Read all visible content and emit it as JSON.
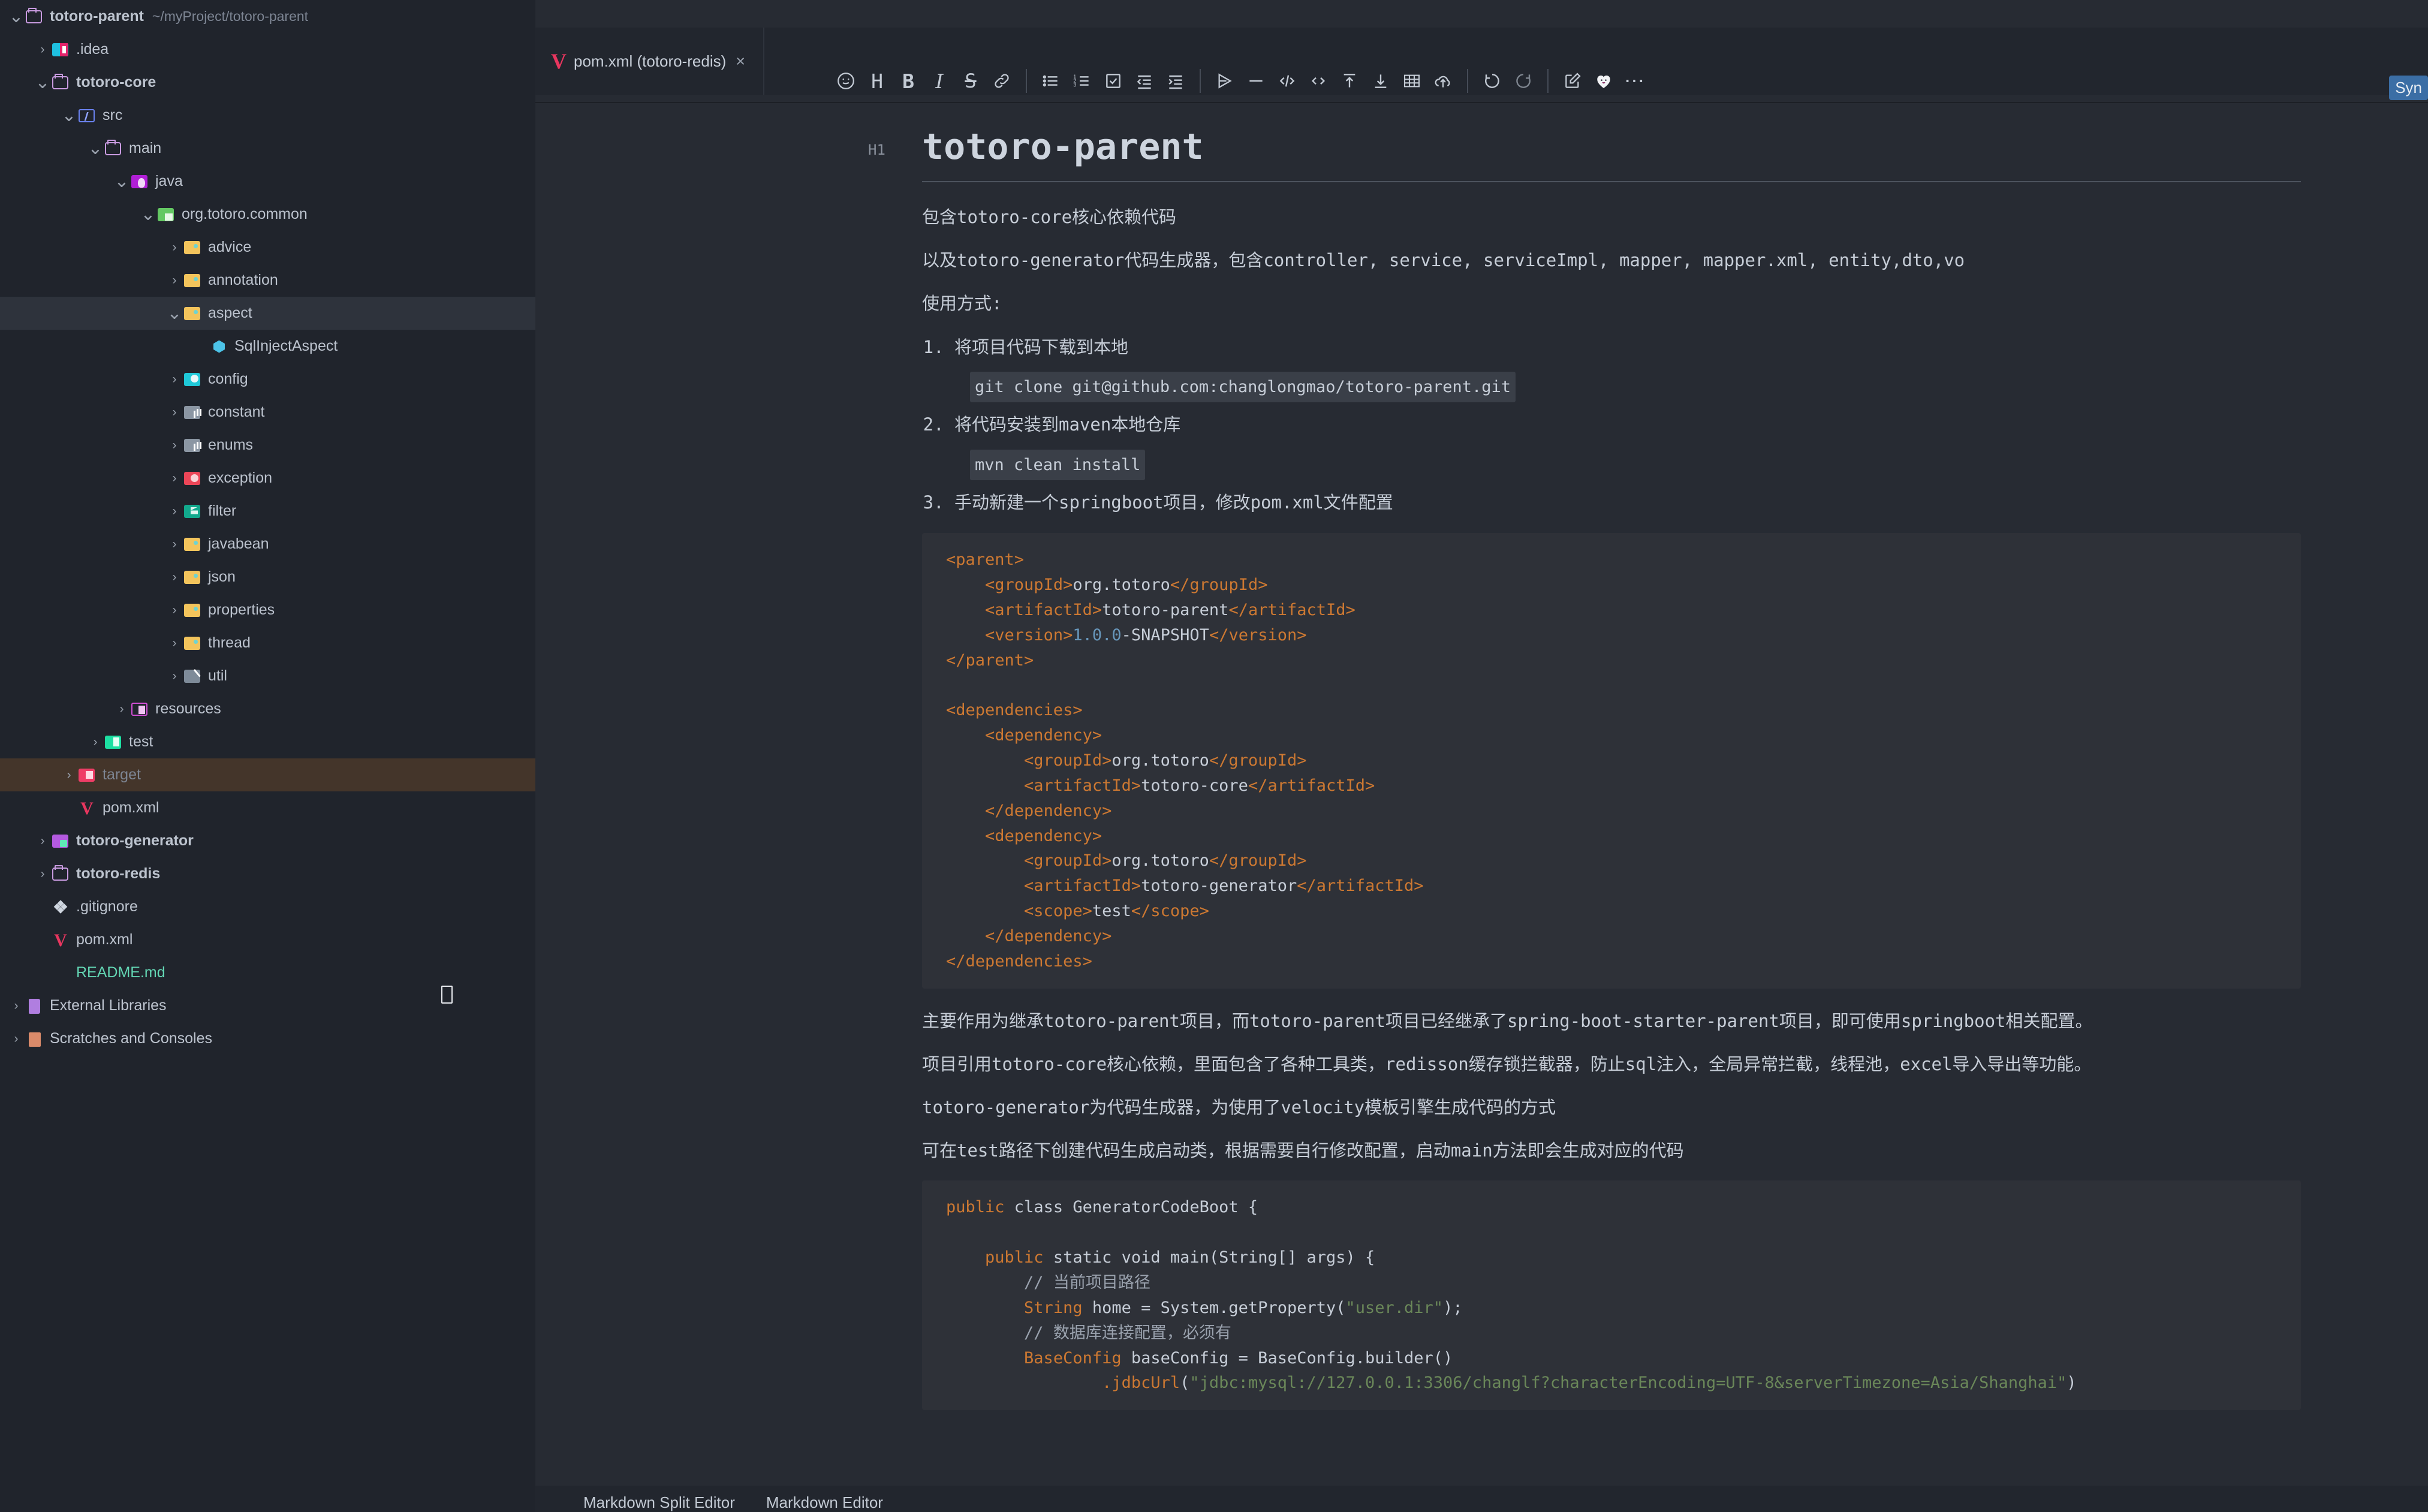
{
  "window": {
    "sync_badge": "Syn"
  },
  "sidebar": {
    "items": [
      {
        "label": "totoro-parent",
        "path": "~/myProject/totoro-parent",
        "indent": 0,
        "arrow": "v",
        "icon": "folder-plain-icon",
        "iconclass": "fi plain",
        "bold": true,
        "state": "normal"
      },
      {
        "label": ".idea",
        "path": "",
        "indent": 1,
        "arrow": ">",
        "icon": "idea-folder-icon",
        "iconclass": "fi idea",
        "bold": false,
        "state": "normal"
      },
      {
        "label": "totoro-core",
        "path": "",
        "indent": 1,
        "arrow": "v",
        "icon": "folder-plain-icon",
        "iconclass": "fi plain",
        "bold": true,
        "state": "normal"
      },
      {
        "label": "src",
        "path": "",
        "indent": 2,
        "arrow": "v",
        "icon": "source-root-icon",
        "iconclass": "fi srcblue",
        "bold": false,
        "state": "normal"
      },
      {
        "label": "main",
        "path": "",
        "indent": 3,
        "arrow": "v",
        "icon": "folder-plain-icon",
        "iconclass": "fi plain",
        "bold": false,
        "state": "normal"
      },
      {
        "label": "java",
        "path": "",
        "indent": 4,
        "arrow": "v",
        "icon": "java-source-folder-icon",
        "iconclass": "fi javafolder",
        "bold": false,
        "state": "normal"
      },
      {
        "label": "org.totoro.common",
        "path": "",
        "indent": 5,
        "arrow": "v",
        "icon": "package-icon",
        "iconclass": "fi greenpkg",
        "bold": false,
        "state": "normal"
      },
      {
        "label": "advice",
        "path": "",
        "indent": 6,
        "arrow": ">",
        "icon": "folder-yellow-icon",
        "iconclass": "fi yellow",
        "bold": false,
        "state": "normal"
      },
      {
        "label": "annotation",
        "path": "",
        "indent": 6,
        "arrow": ">",
        "icon": "folder-yellow-icon",
        "iconclass": "fi yellow",
        "bold": false,
        "state": "normal"
      },
      {
        "label": "aspect",
        "path": "",
        "indent": 6,
        "arrow": "v",
        "icon": "folder-yellow-icon",
        "iconclass": "fi yellow",
        "bold": false,
        "state": "selected"
      },
      {
        "label": "SqlInjectAspect",
        "path": "",
        "indent": 7,
        "arrow": "",
        "icon": "java-class-icon",
        "iconclass": "fx javacls",
        "bold": false,
        "state": "normal"
      },
      {
        "label": "config",
        "path": "",
        "indent": 6,
        "arrow": ">",
        "icon": "folder-config-icon",
        "iconclass": "fi cyan",
        "bold": false,
        "state": "normal"
      },
      {
        "label": "constant",
        "path": "",
        "indent": 6,
        "arrow": ">",
        "icon": "folder-constant-icon",
        "iconclass": "fi grey",
        "bold": false,
        "state": "normal"
      },
      {
        "label": "enums",
        "path": "",
        "indent": 6,
        "arrow": ">",
        "icon": "folder-enum-icon",
        "iconclass": "fi grey",
        "bold": false,
        "state": "normal"
      },
      {
        "label": "exception",
        "path": "",
        "indent": 6,
        "arrow": ">",
        "icon": "folder-exception-icon",
        "iconclass": "fi red",
        "bold": false,
        "state": "normal"
      },
      {
        "label": "filter",
        "path": "",
        "indent": 6,
        "arrow": ">",
        "icon": "folder-filter-icon",
        "iconclass": "fi teal",
        "bold": false,
        "state": "normal"
      },
      {
        "label": "javabean",
        "path": "",
        "indent": 6,
        "arrow": ">",
        "icon": "folder-yellow-icon",
        "iconclass": "fi yellow",
        "bold": false,
        "state": "normal"
      },
      {
        "label": "json",
        "path": "",
        "indent": 6,
        "arrow": ">",
        "icon": "folder-json-icon",
        "iconclass": "fi yellow",
        "bold": false,
        "state": "normal"
      },
      {
        "label": "properties",
        "path": "",
        "indent": 6,
        "arrow": ">",
        "icon": "folder-yellow-icon",
        "iconclass": "fi yellow",
        "bold": false,
        "state": "normal"
      },
      {
        "label": "thread",
        "path": "",
        "indent": 6,
        "arrow": ">",
        "icon": "folder-yellow-icon",
        "iconclass": "fi yellow",
        "bold": false,
        "state": "normal"
      },
      {
        "label": "util",
        "path": "",
        "indent": 6,
        "arrow": ">",
        "icon": "folder-util-icon",
        "iconclass": "fi greysl",
        "bold": false,
        "state": "normal"
      },
      {
        "label": "resources",
        "path": "",
        "indent": 4,
        "arrow": ">",
        "icon": "resources-root-icon",
        "iconclass": "fi magenta",
        "bold": false,
        "state": "normal"
      },
      {
        "label": "test",
        "path": "",
        "indent": 3,
        "arrow": ">",
        "icon": "test-root-icon",
        "iconclass": "fi emerald",
        "bold": false,
        "state": "normal"
      },
      {
        "label": "target",
        "path": "",
        "indent": 2,
        "arrow": ">",
        "icon": "excluded-folder-icon",
        "iconclass": "fi pinkred",
        "bold": false,
        "state": "target"
      },
      {
        "label": "pom.xml",
        "path": "",
        "indent": 2,
        "arrow": "",
        "icon": "maven-file-icon",
        "iconclass": "fx maven",
        "bold": false,
        "state": "normal"
      },
      {
        "label": "totoro-generator",
        "path": "",
        "indent": 1,
        "arrow": ">",
        "icon": "module-folder-icon",
        "iconclass": "fi purple",
        "bold": true,
        "state": "normal"
      },
      {
        "label": "totoro-redis",
        "path": "",
        "indent": 1,
        "arrow": ">",
        "icon": "folder-plain-icon",
        "iconclass": "fi plain",
        "bold": true,
        "state": "normal"
      },
      {
        "label": ".gitignore",
        "path": "",
        "indent": 1,
        "arrow": "",
        "icon": "git-file-icon",
        "iconclass": "fx git",
        "bold": false,
        "state": "normal"
      },
      {
        "label": "pom.xml",
        "path": "",
        "indent": 1,
        "arrow": "",
        "icon": "maven-file-icon",
        "iconclass": "fx maven",
        "bold": false,
        "state": "normal"
      },
      {
        "label": "README.md",
        "path": "",
        "indent": 1,
        "arrow": "",
        "icon": "markdown-file-icon",
        "iconclass": "fx md",
        "bold": false,
        "state": "green"
      },
      {
        "label": "External Libraries",
        "path": "",
        "indent": 0,
        "arrow": ">",
        "icon": "library-icon",
        "iconclass": "fx lib",
        "bold": false,
        "state": "normal"
      },
      {
        "label": "Scratches and Consoles",
        "path": "",
        "indent": 0,
        "arrow": ">",
        "icon": "scratches-icon",
        "iconclass": "fx scratch",
        "bold": false,
        "state": "normal"
      }
    ]
  },
  "editor": {
    "tab": {
      "label": "pom.xml (totoro-redis)",
      "close": "×",
      "icon": "V"
    },
    "toolbar": [
      {
        "name": "emoji-icon",
        "label": "emoji"
      },
      {
        "name": "heading-icon",
        "label": "H"
      },
      {
        "name": "bold-icon",
        "label": "B"
      },
      {
        "name": "italic-icon",
        "label": "I"
      },
      {
        "name": "strikethrough-icon",
        "label": "S"
      },
      {
        "name": "link-icon",
        "label": "link"
      },
      {
        "name": "bullet-list-icon",
        "label": "bullet list"
      },
      {
        "name": "numbered-list-icon",
        "label": "numbered list"
      },
      {
        "name": "task-list-icon",
        "label": "task list"
      },
      {
        "name": "outdent-icon",
        "label": "outdent"
      },
      {
        "name": "indent-icon",
        "label": "indent"
      },
      {
        "name": "blockquote-icon",
        "label": "blockquote"
      },
      {
        "name": "horizontal-rule-icon",
        "label": "horizontal rule"
      },
      {
        "name": "code-block-icon",
        "label": "code block"
      },
      {
        "name": "inline-code-icon",
        "label": "inline code"
      },
      {
        "name": "move-up-icon",
        "label": "move up"
      },
      {
        "name": "move-down-icon",
        "label": "move down"
      },
      {
        "name": "table-icon",
        "label": "table"
      },
      {
        "name": "upload-icon",
        "label": "upload"
      },
      {
        "name": "undo-icon",
        "label": "undo"
      },
      {
        "name": "redo-icon",
        "label": "redo"
      },
      {
        "name": "edit-icon",
        "label": "edit"
      },
      {
        "name": "heart-icon",
        "label": "heart"
      },
      {
        "name": "more-icon",
        "label": "more"
      }
    ],
    "bottom_tabs": [
      {
        "label": "Markdown Split Editor"
      },
      {
        "label": "Markdown Editor"
      }
    ]
  },
  "document": {
    "h1_marker": "H1",
    "title": "totoro-parent",
    "p1": "包含totoro-core核心依赖代码",
    "p2": "以及totoro-generator代码生成器，包含controller, service, serviceImpl, mapper, mapper.xml, entity,dto,vo",
    "p3": "使用方式:",
    "list": [
      {
        "text_before": "将项目代码下载到本地",
        "code": "git clone git@github.com:changlongmao/totoro-parent.git"
      },
      {
        "text_before": "将代码安装到maven本地仓库",
        "code": "mvn clean install"
      },
      {
        "text_before": "手动新建一个springboot项目，修改pom.xml文件配置",
        "code": ""
      }
    ],
    "xml_block": {
      "lines": [
        {
          "tag": "<parent>",
          "indent": 0
        },
        {
          "tag": "<groupId>",
          "value": "org.totoro",
          "close": "</groupId>",
          "indent": 1
        },
        {
          "tag": "<artifactId>",
          "value": "totoro-parent",
          "close": "</artifactId>",
          "indent": 1
        },
        {
          "tag": "<version>",
          "value": "1.0.0-SNAPSHOT",
          "close": "</version>",
          "indent": 1
        },
        {
          "tag": "</parent>",
          "indent": 0
        },
        {
          "tag": "",
          "indent": 0
        },
        {
          "tag": "<dependencies>",
          "indent": 0
        },
        {
          "tag": "<dependency>",
          "indent": 1
        },
        {
          "tag": "<groupId>",
          "value": "org.totoro",
          "close": "</groupId>",
          "indent": 2
        },
        {
          "tag": "<artifactId>",
          "value": "totoro-core",
          "close": "</artifactId>",
          "indent": 2
        },
        {
          "tag": "</dependency>",
          "indent": 1
        },
        {
          "tag": "<dependency>",
          "indent": 1
        },
        {
          "tag": "<groupId>",
          "value": "org.totoro",
          "close": "</groupId>",
          "indent": 2
        },
        {
          "tag": "<artifactId>",
          "value": "totoro-generator",
          "close": "</artifactId>",
          "indent": 2
        },
        {
          "tag": "<scope>",
          "value": "test",
          "close": "</scope>",
          "indent": 2
        },
        {
          "tag": "</dependency>",
          "indent": 1
        },
        {
          "tag": "</dependencies>",
          "indent": 0
        }
      ]
    },
    "p4": "主要作用为继承totoro-parent项目，而totoro-parent项目已经继承了spring-boot-starter-parent项目，即可使用springboot相关配置。",
    "p5": "项目引用totoro-core核心依赖，里面包含了各种工具类，redisson缓存锁拦截器，防止sql注入，全局异常拦截，线程池，excel导入导出等功能。",
    "p6": "totoro-generator为代码生成器，为使用了velocity模板引擎生成代码的方式",
    "p7": "可在test路径下创建代码生成启动类，根据需要自行修改配置，启动main方法即会生成对应的代码",
    "java_block": {
      "l1_kw": "public",
      "l1_rest": " class GeneratorCodeBoot {",
      "l2_kw": "public",
      "l2_rest": " static void main(String[] args) {",
      "l3_comment": "// 当前项目路径",
      "l4_type": "String",
      "l4_mid": " home = System.getProperty(",
      "l4_str": "\"user.dir\"",
      "l4_end": ");",
      "l5_comment": "// 数据库连接配置，必须有",
      "l6_type": "BaseConfig",
      "l6_rest": " baseConfig = BaseConfig.builder()",
      "l7_method": ".jdbcUrl",
      "l7_str": "\"jdbc:mysql://127.0.0.1:3306/changlf?characterEncoding=UTF-8&serverTimezone=Asia/Shanghai\""
    }
  }
}
